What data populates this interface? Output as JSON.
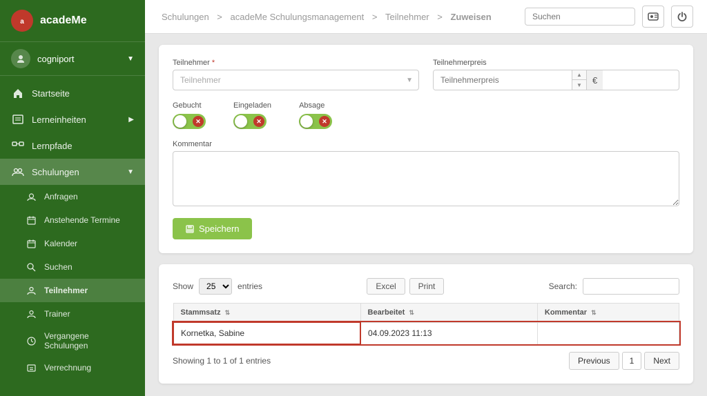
{
  "app": {
    "name": "acadeMe",
    "org": "cogniport"
  },
  "sidebar": {
    "items": [
      {
        "id": "startseite",
        "label": "Startseite"
      },
      {
        "id": "lerneinheiten",
        "label": "Lerneinheiten",
        "hasArrow": true
      },
      {
        "id": "lernpfade",
        "label": "Lernpfade"
      },
      {
        "id": "schulungen",
        "label": "Schulungen",
        "hasArrow": true,
        "active": true
      }
    ],
    "sub_items": [
      {
        "id": "anfragen",
        "label": "Anfragen"
      },
      {
        "id": "anstehende-termine",
        "label": "Anstehende Termine"
      },
      {
        "id": "kalender",
        "label": "Kalender"
      },
      {
        "id": "suchen",
        "label": "Suchen"
      },
      {
        "id": "teilnehmer",
        "label": "Teilnehmer",
        "active": true
      },
      {
        "id": "trainer",
        "label": "Trainer"
      },
      {
        "id": "vergangene-schulungen",
        "label": "Vergangene Schulungen"
      },
      {
        "id": "verrechnung",
        "label": "Verrechnung"
      }
    ]
  },
  "breadcrumb": {
    "items": [
      "Schulungen",
      "acadeMe Schulungsmanagement",
      "Teilnehmer",
      "Zuweisen"
    ],
    "separators": [
      ">",
      ">",
      ">"
    ]
  },
  "topbar": {
    "search_placeholder": "Suchen"
  },
  "form": {
    "teilnehmer_label": "Teilnehmer",
    "teilnehmer_placeholder": "Teilnehmer",
    "teilnehmerpreis_label": "Teilnehmerpreis",
    "teilnehmerpreis_placeholder": "Teilnehmerpreis",
    "gebucht_label": "Gebucht",
    "eingeladen_label": "Eingeladen",
    "absage_label": "Absage",
    "kommentar_label": "Kommentar",
    "save_label": "Speichern"
  },
  "table": {
    "show_label": "Show",
    "entries_label": "entries",
    "entries_value": "25",
    "excel_label": "Excel",
    "print_label": "Print",
    "search_label": "Search:",
    "columns": [
      {
        "label": "Stammsatz",
        "sort": true
      },
      {
        "label": "Bearbeitet",
        "sort": true
      },
      {
        "label": "Kommentar",
        "sort": true
      }
    ],
    "rows": [
      {
        "stammsatz": "Kornetka, Sabine",
        "bearbeitet": "04.09.2023 11:13",
        "kommentar": "",
        "highlighted": true
      }
    ],
    "showing_text": "Showing 1 to 1 of 1 entries",
    "pagination": {
      "previous_label": "Previous",
      "next_label": "Next",
      "current_page": "1"
    }
  }
}
